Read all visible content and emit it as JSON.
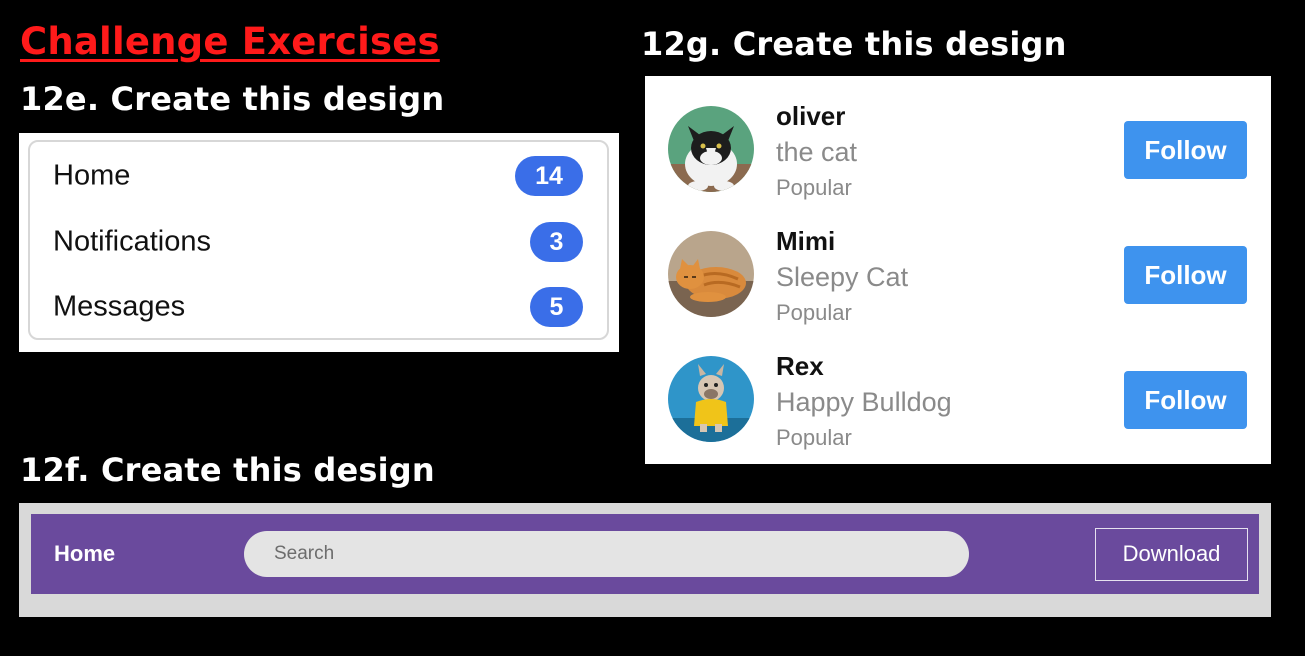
{
  "headings": {
    "main": "Challenge Exercises",
    "e": "12e. Create this design",
    "g": "12g. Create this design",
    "f": "12f. Create this design"
  },
  "menu": {
    "items": [
      {
        "label": "Home",
        "count": "14"
      },
      {
        "label": "Notifications",
        "count": "3"
      },
      {
        "label": "Messages",
        "count": "5"
      }
    ],
    "badge_color": "#3a6ee8"
  },
  "profiles": {
    "items": [
      {
        "name": "oliver",
        "subtitle": "the cat",
        "tag": "Popular",
        "button": "Follow",
        "avatar": "cat-avatar-icon"
      },
      {
        "name": "Mimi",
        "subtitle": "Sleepy Cat",
        "tag": "Popular",
        "button": "Follow",
        "avatar": "cat-avatar-icon"
      },
      {
        "name": "Rex",
        "subtitle": "Happy Bulldog",
        "tag": "Popular",
        "button": "Follow",
        "avatar": "dog-avatar-icon"
      }
    ],
    "button_color": "#3e93ee"
  },
  "navbar": {
    "home_label": "Home",
    "search_placeholder": "Search",
    "download_label": "Download",
    "bar_color": "#6a4a9d"
  },
  "colors": {
    "challenge_title": "#ff1a1a",
    "background": "#000000"
  }
}
